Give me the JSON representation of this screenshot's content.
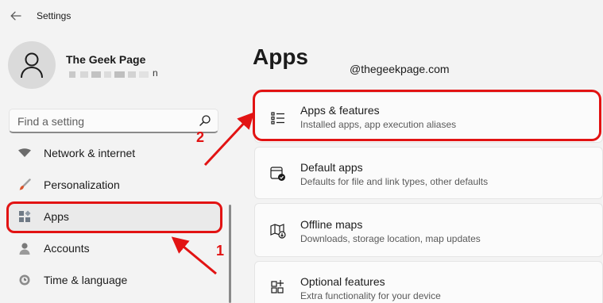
{
  "window": {
    "title": "Settings",
    "back_icon": "back-arrow-icon"
  },
  "user": {
    "name": "The Geek Page",
    "email_visible_tail": "n"
  },
  "search": {
    "placeholder": "Find a setting",
    "icon": "search-icon"
  },
  "sidebar": {
    "items": [
      {
        "label": "Network & internet",
        "icon": "wifi-icon"
      },
      {
        "label": "Personalization",
        "icon": "brush-icon"
      },
      {
        "label": "Apps",
        "icon": "apps-icon",
        "selected": true
      },
      {
        "label": "Accounts",
        "icon": "person-icon"
      },
      {
        "label": "Time & language",
        "icon": "clock-globe-icon"
      }
    ]
  },
  "main": {
    "title": "Apps",
    "watermark": "@thegeekpage.com",
    "cards": [
      {
        "title": "Apps & features",
        "desc": "Installed apps, app execution aliases",
        "icon": "list-icon"
      },
      {
        "title": "Default apps",
        "desc": "Defaults for file and link types, other defaults",
        "icon": "default-apps-icon"
      },
      {
        "title": "Offline maps",
        "desc": "Downloads, storage location, map updates",
        "icon": "map-icon"
      },
      {
        "title": "Optional features",
        "desc": "Extra functionality for your device",
        "icon": "optional-features-icon"
      }
    ]
  },
  "annotations": {
    "step1": "1",
    "step2": "2",
    "color": "#e21313"
  },
  "colors": {
    "background": "#f3f3f3",
    "card": "#fbfbfb",
    "selected_nav": "#eaeaea",
    "accent_red": "#e21313"
  }
}
